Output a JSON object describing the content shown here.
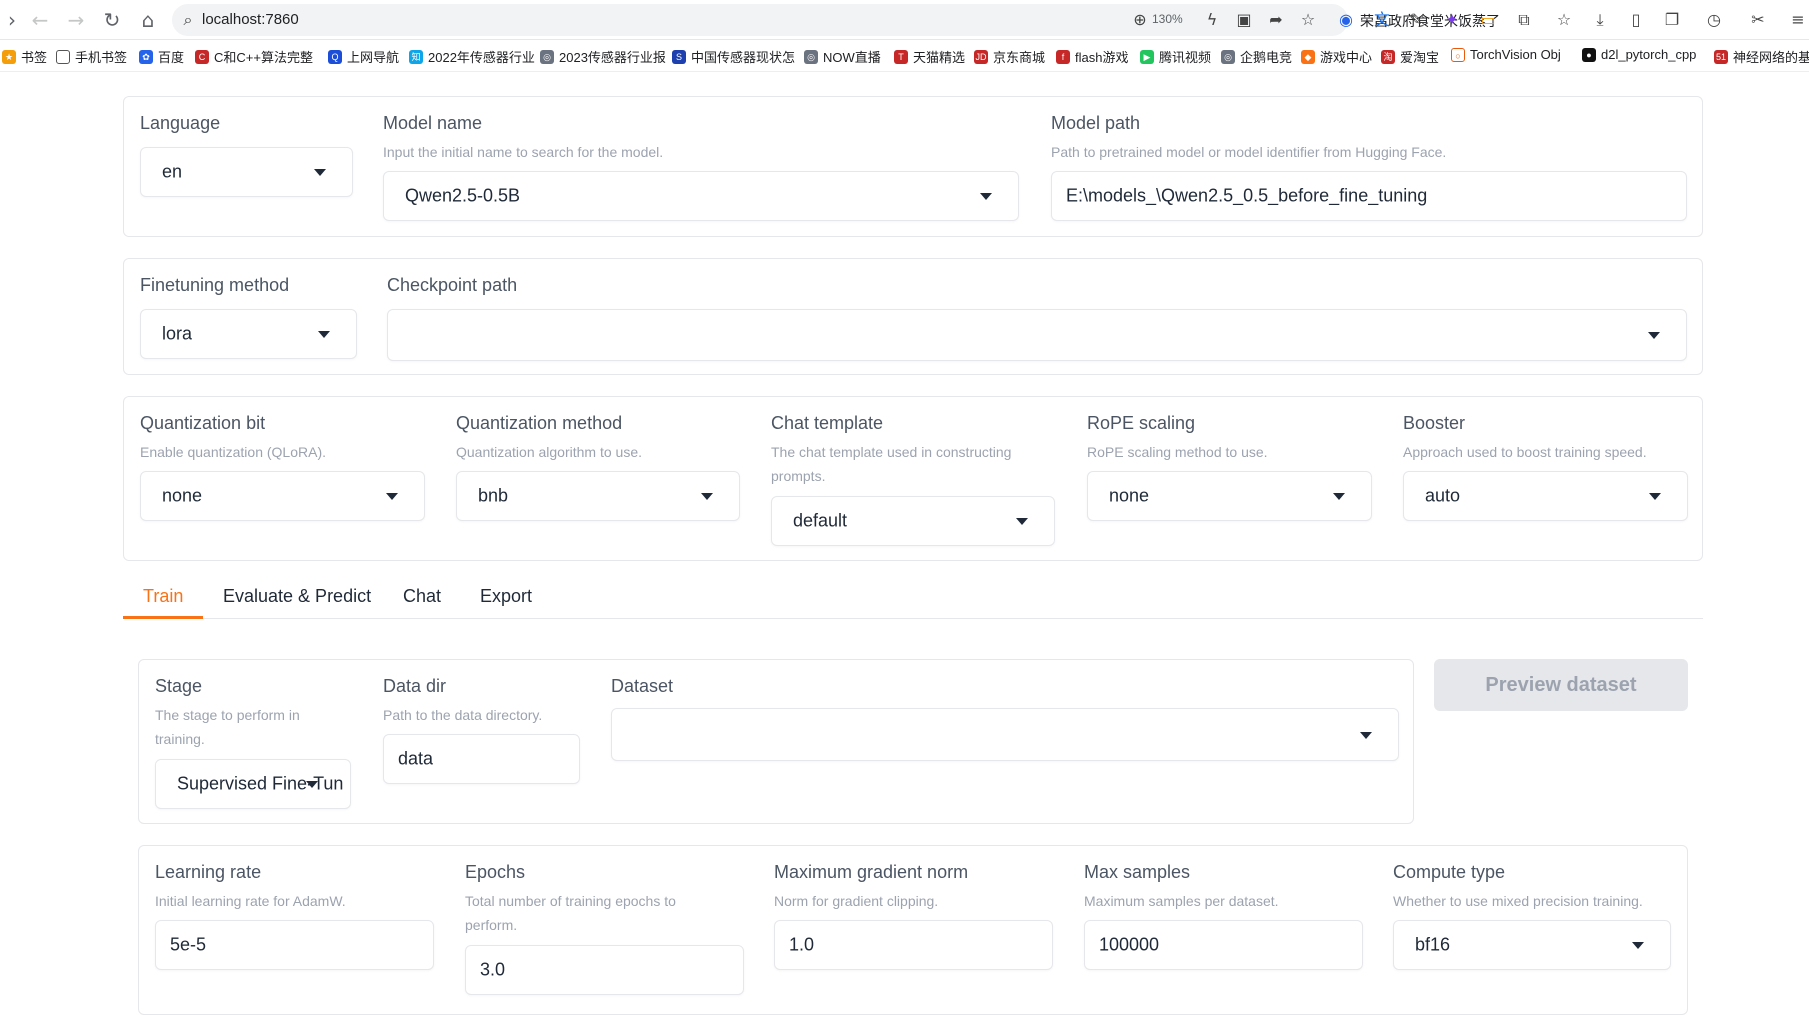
{
  "browser": {
    "url": "localhost:7860",
    "zoom": "130%",
    "news_text": "荣昌政府食堂米饭蒸了"
  },
  "bookmarks": [
    "书签",
    "手机书签",
    "百度",
    "C和C++算法完整",
    "上网导航",
    "2022年传感器行业",
    "2023传感器行业报",
    "中国传感器现状怎",
    "NOW直播",
    "天猫精选",
    "京东商城",
    "flash游戏",
    "腾讯视频",
    "企鹅电竞",
    "游戏中心",
    "爱淘宝",
    "TorchVision Obj",
    "d2l_pytorch_cpp",
    "神经网络的基"
  ],
  "top": {
    "language": {
      "label": "Language",
      "value": "en"
    },
    "model_name": {
      "label": "Model name",
      "info": "Input the initial name to search for the model.",
      "value": "Qwen2.5-0.5B"
    },
    "model_path": {
      "label": "Model path",
      "info": "Path to pretrained model or model identifier from Hugging Face.",
      "value": "E:\\models_\\Qwen2.5_0.5_before_fine_tuning"
    }
  },
  "finetune": {
    "method": {
      "label": "Finetuning method",
      "value": "lora"
    },
    "checkpoint": {
      "label": "Checkpoint path",
      "value": ""
    }
  },
  "advanced": {
    "quant_bit": {
      "label": "Quantization bit",
      "info": "Enable quantization (QLoRA).",
      "value": "none"
    },
    "quant_method": {
      "label": "Quantization method",
      "info": "Quantization algorithm to use.",
      "value": "bnb"
    },
    "chat_template": {
      "label": "Chat template",
      "info": "The chat template used in constructing prompts.",
      "value": "default"
    },
    "rope": {
      "label": "RoPE scaling",
      "info": "RoPE scaling method to use.",
      "value": "none"
    },
    "booster": {
      "label": "Booster",
      "info": "Approach used to boost training speed.",
      "value": "auto"
    }
  },
  "tabs": [
    "Train",
    "Evaluate & Predict",
    "Chat",
    "Export"
  ],
  "train": {
    "stage": {
      "label": "Stage",
      "info": "The stage to perform in training.",
      "value": "Supervised Fine-Tun"
    },
    "data_dir": {
      "label": "Data dir",
      "info": "Path to the data directory.",
      "value": "data"
    },
    "dataset": {
      "label": "Dataset",
      "value": ""
    },
    "preview_button": "Preview dataset",
    "learning_rate": {
      "label": "Learning rate",
      "info": "Initial learning rate for AdamW.",
      "value": "5e-5"
    },
    "epochs": {
      "label": "Epochs",
      "info": "Total number of training epochs to perform.",
      "value": "3.0"
    },
    "max_grad_norm": {
      "label": "Maximum gradient norm",
      "info": "Norm for gradient clipping.",
      "value": "1.0"
    },
    "max_samples": {
      "label": "Max samples",
      "info": "Maximum samples per dataset.",
      "value": "100000"
    },
    "compute_type": {
      "label": "Compute type",
      "info": "Whether to use mixed precision training.",
      "value": "bf16"
    }
  },
  "colors": {
    "accent": "#f97316",
    "border": "#e5e7eb",
    "muted": "#9ca3af"
  }
}
